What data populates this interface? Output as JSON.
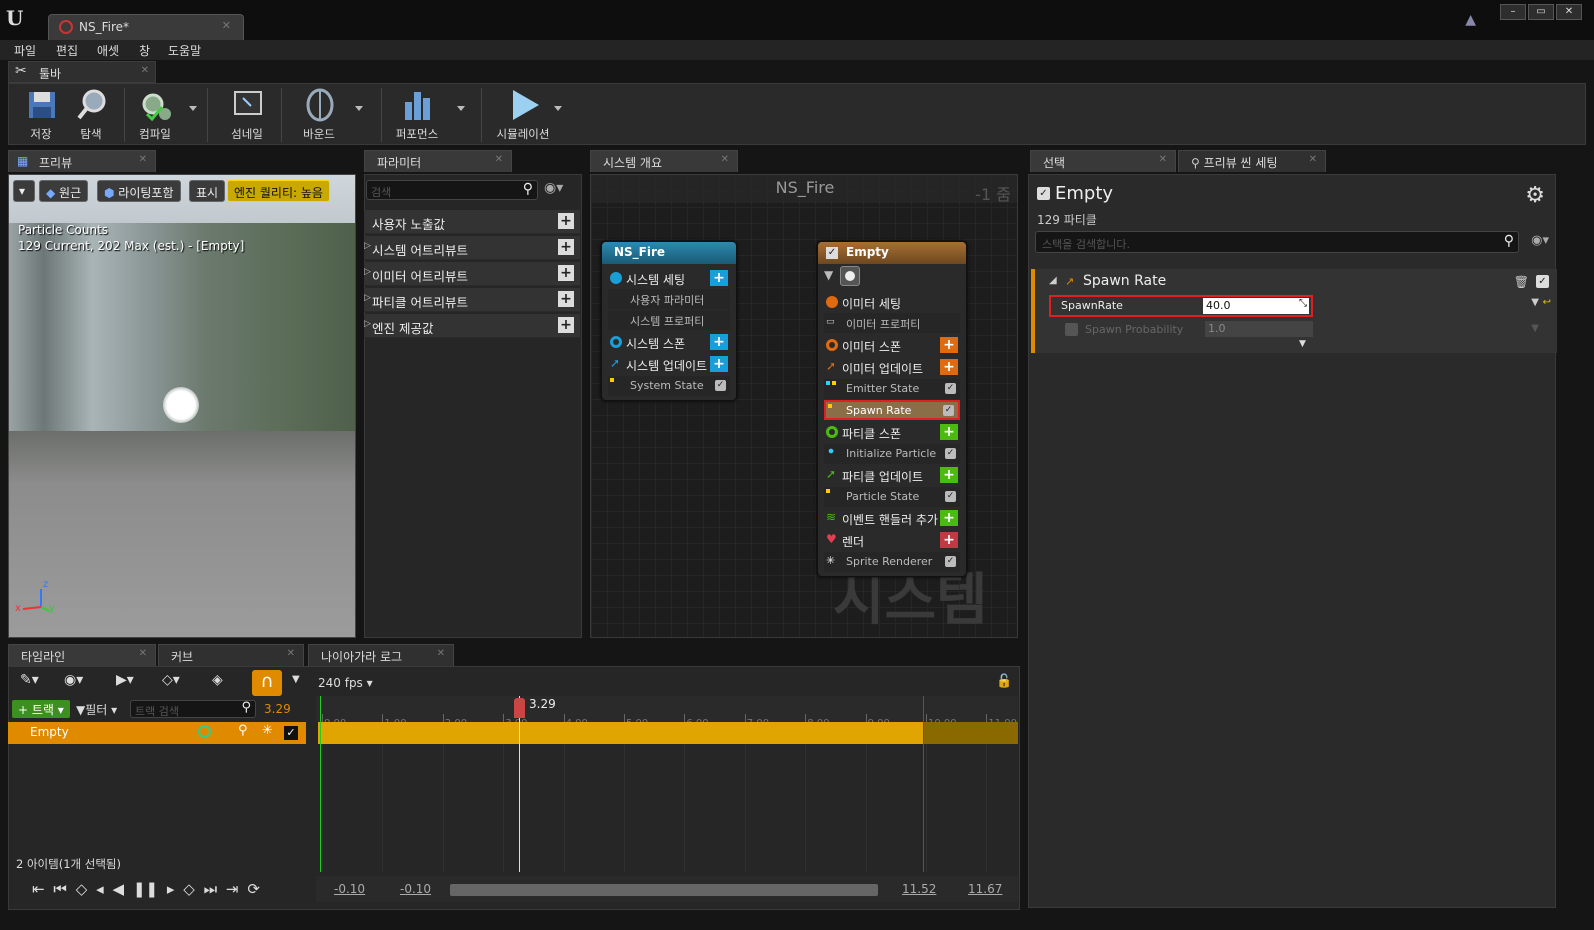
{
  "app": {
    "tab_title": "NS_Fire*",
    "window_buttons": [
      "–",
      "▭",
      "✕"
    ]
  },
  "menu": [
    "파일",
    "편집",
    "애셋",
    "창",
    "도움말"
  ],
  "toolbar": {
    "tab_label": "툴바",
    "buttons": [
      "저장",
      "탐색",
      "컴파일",
      "섬네일",
      "바운드",
      "퍼포먼스",
      "시뮬레이션"
    ]
  },
  "preview": {
    "tab_label": "프리뷰",
    "buttons": {
      "perspective": "원근",
      "lighting": "라이팅포함",
      "show": "표시",
      "quality": "엔진 퀄리티: 높음"
    },
    "overlay_title": "Particle Counts",
    "overlay_line": "129 Current, 202 Max (est.) - [Empty]",
    "axes": {
      "x": "x",
      "y": "y",
      "z": "z"
    }
  },
  "parameters": {
    "tab_label": "파라미터",
    "search_placeholder": "검색",
    "rows": [
      "사용자 노출값",
      "시스템 어트리뷰트",
      "이미터 어트리뷰트",
      "파티클 어트리뷰트",
      "엔진 제공값"
    ],
    "expand_arrow": "▷"
  },
  "overview": {
    "tab_label": "시스템 개요",
    "graph_title": "NS_Fire",
    "zoom": "-1 줌",
    "watermark": "시스템",
    "system_node": {
      "title": "NS_Fire",
      "rows": [
        "시스템 세팅",
        "사용자 파라미터",
        "시스템 프로퍼티",
        "시스템 스폰",
        "시스템 업데이트",
        "System State"
      ]
    },
    "emitter_node": {
      "title": "Empty",
      "rows": [
        "이미터 세팅",
        "이미터 프로퍼티",
        "이미터 스폰",
        "이미터 업데이트",
        "Emitter State",
        "Spawn Rate",
        "파티클 스폰",
        "Initialize Particle",
        "파티클 업데이트",
        "Particle State",
        "이벤트 핸들러 추가",
        "렌더",
        "Sprite Renderer"
      ]
    }
  },
  "details": {
    "tab_selection": "선택",
    "tab_preview_scene": "프리뷰 씬 세팅",
    "emitter_name": "Empty",
    "particle_count": "129 파티클",
    "search_placeholder": "스택을 검색합니다.",
    "module_title": "Spawn Rate",
    "fields": [
      {
        "label": "SpawnRate",
        "value": "40.0"
      },
      {
        "label": "Spawn Probability",
        "value": "1.0"
      }
    ]
  },
  "timeline": {
    "tabs": [
      "타임라인",
      "커브",
      "나이아가라 로그"
    ],
    "fps": "240 fps",
    "track_button": "트랙",
    "filter_button": "필터",
    "search_placeholder": "트랙 검색",
    "current_time": "3.29",
    "playhead_label": "3.29",
    "track_name": "Empty",
    "ticks": [
      "0.00",
      "1.00",
      "2.00",
      "3.00",
      "4.00",
      "5.00",
      "6.00",
      "7.00",
      "8.00",
      "9.00",
      "10.00",
      "11.00"
    ],
    "item_count": "2 아이템(1개 선택됨)",
    "range_start": "-0.10",
    "range_start2": "-0.10",
    "range_end": "11.52",
    "range_end2": "11.67"
  },
  "colors": {
    "track_orange": "#e0a500",
    "accent_orange": "#e08a00",
    "highlight_red": "#e02020",
    "system_node_header": "#1f6f8f",
    "emitter_node_header": "#8a5c2a"
  }
}
